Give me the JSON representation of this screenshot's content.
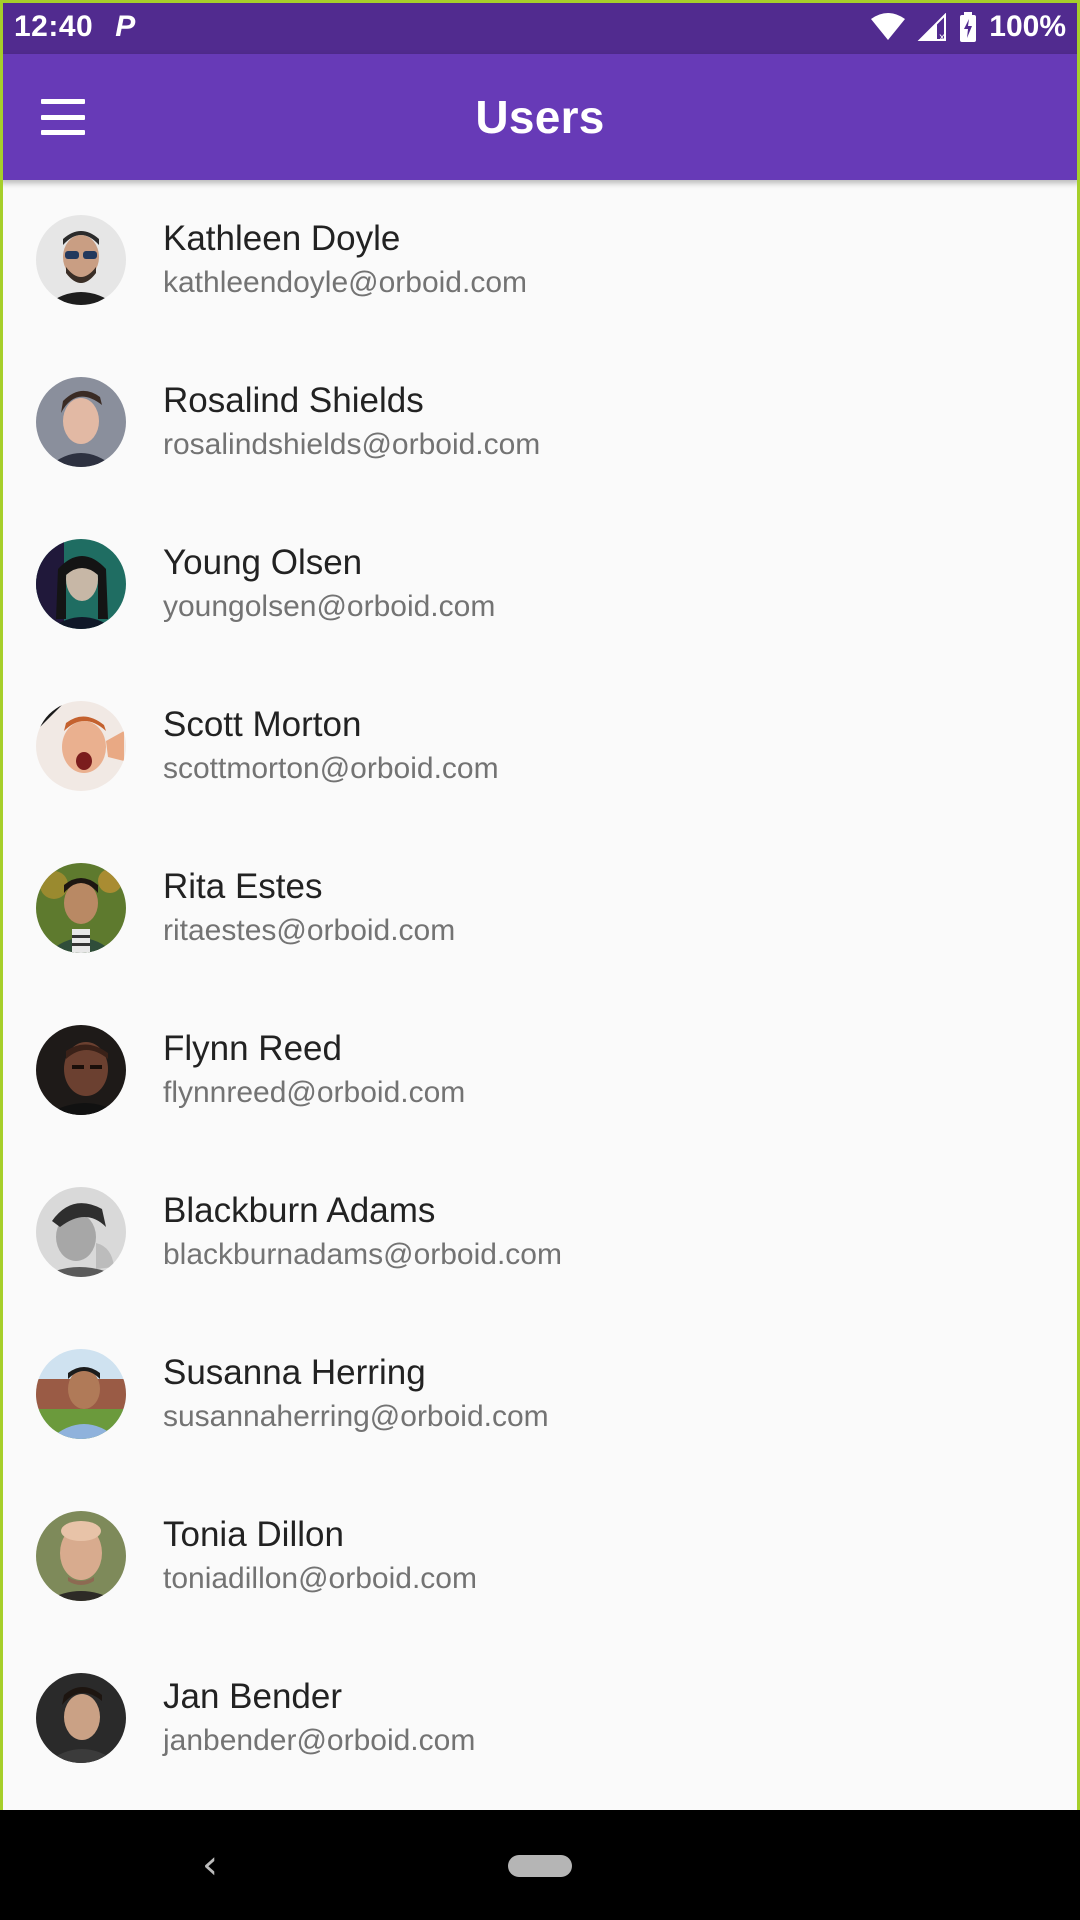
{
  "status_bar": {
    "time": "12:40",
    "notification_icon": "P",
    "battery": "100%",
    "icons": [
      "wifi-icon",
      "cell-signal-icon",
      "battery-charging-icon"
    ]
  },
  "app_bar": {
    "title": "Users",
    "menu_icon": "hamburger-menu-icon",
    "color": "#673ab7"
  },
  "users": [
    {
      "name": "Kathleen Doyle",
      "email": "kathleendoyle@orboid.com"
    },
    {
      "name": "Rosalind Shields",
      "email": "rosalindshields@orboid.com"
    },
    {
      "name": "Young Olsen",
      "email": "youngolsen@orboid.com"
    },
    {
      "name": "Scott Morton",
      "email": "scottmorton@orboid.com"
    },
    {
      "name": "Rita Estes",
      "email": "ritaestes@orboid.com"
    },
    {
      "name": "Flynn Reed",
      "email": "flynnreed@orboid.com"
    },
    {
      "name": "Blackburn Adams",
      "email": "blackburnadams@orboid.com"
    },
    {
      "name": "Susanna Herring",
      "email": "susannaherring@orboid.com"
    },
    {
      "name": "Tonia Dillon",
      "email": "toniadillon@orboid.com"
    },
    {
      "name": "Jan Bender",
      "email": "janbender@orboid.com"
    }
  ],
  "nav_bar": {
    "back_icon": "‹",
    "home_icon": "home-pill-icon"
  }
}
